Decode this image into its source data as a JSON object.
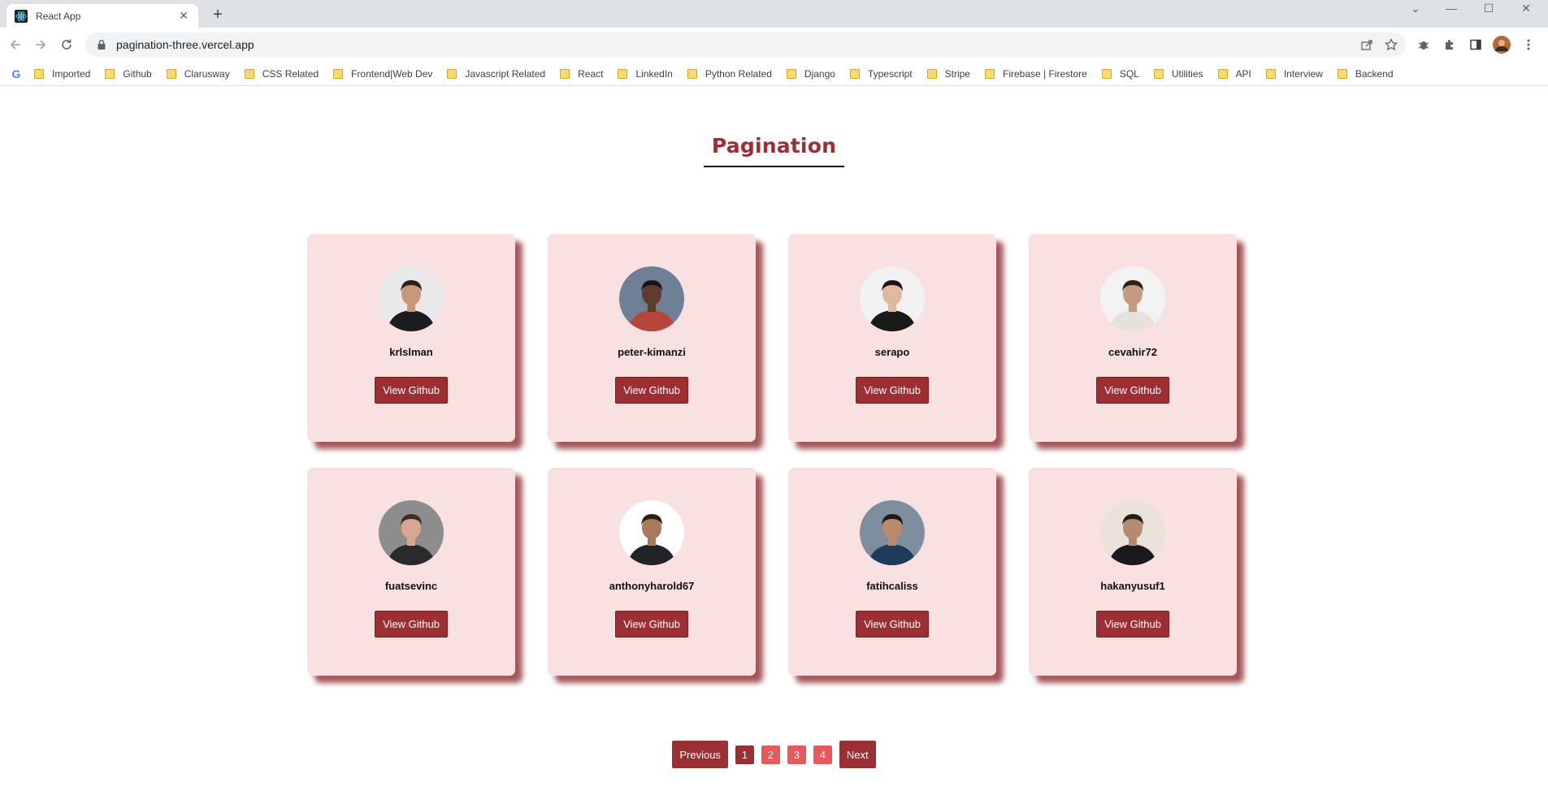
{
  "browser": {
    "tab_title": "React App",
    "url": "pagination-three.vercel.app",
    "bookmarks": [
      "Imported",
      "Github",
      "Clarusway",
      "CSS Related",
      "Frontend|Web Dev",
      "Javascript Related",
      "React",
      "LinkedIn",
      "Python Related",
      "Django",
      "Typescript",
      "Stripe",
      "Firebase | Firestore",
      "SQL",
      "Utilities",
      "API",
      "Interview",
      "Backend"
    ]
  },
  "page": {
    "title": "Pagination",
    "button_label": "View Github",
    "users": [
      {
        "name": "krlslman",
        "avatar_bg": "#e9e9e9",
        "skin": "#c89877",
        "hair": "#2a211b",
        "shirt": "#1c1c1f"
      },
      {
        "name": "peter-kimanzi",
        "avatar_bg": "#6f7f95",
        "skin": "#5e3b2a",
        "hair": "#1a1412",
        "shirt": "#b6463c"
      },
      {
        "name": "serapo",
        "avatar_bg": "#f2f2f2",
        "skin": "#e0b89e",
        "hair": "#1e1614",
        "shirt": "#1a1a1a"
      },
      {
        "name": "cevahir72",
        "avatar_bg": "#f3f3f3",
        "skin": "#c79a7f",
        "hair": "#2b221d",
        "shirt": "#e6e2da"
      },
      {
        "name": "fuatsevinc",
        "avatar_bg": "#8d8d8d",
        "skin": "#d6a892",
        "hair": "#3a2e26",
        "shirt": "#2b2b2e"
      },
      {
        "name": "anthonyharold67",
        "avatar_bg": "#ffffff",
        "skin": "#a8795a",
        "hair": "#2c1e17",
        "shirt": "#222327"
      },
      {
        "name": "fatihcaliss",
        "avatar_bg": "#7e8e9e",
        "skin": "#b98a6c",
        "hair": "#1f1a18",
        "shirt": "#1f3b5c"
      },
      {
        "name": "hakanyusuf1",
        "avatar_bg": "#e8e2d8",
        "skin": "#b48a70",
        "hair": "#241c18",
        "shirt": "#1a1a1d"
      }
    ],
    "pagination": {
      "previous": "Previous",
      "next": "Next",
      "pages": [
        "1",
        "2",
        "3",
        "4"
      ],
      "current": "1"
    }
  },
  "colors": {
    "accent": "#9b2f33",
    "card_bg": "#f9e0e1",
    "page_inactive": "#e8595b"
  }
}
